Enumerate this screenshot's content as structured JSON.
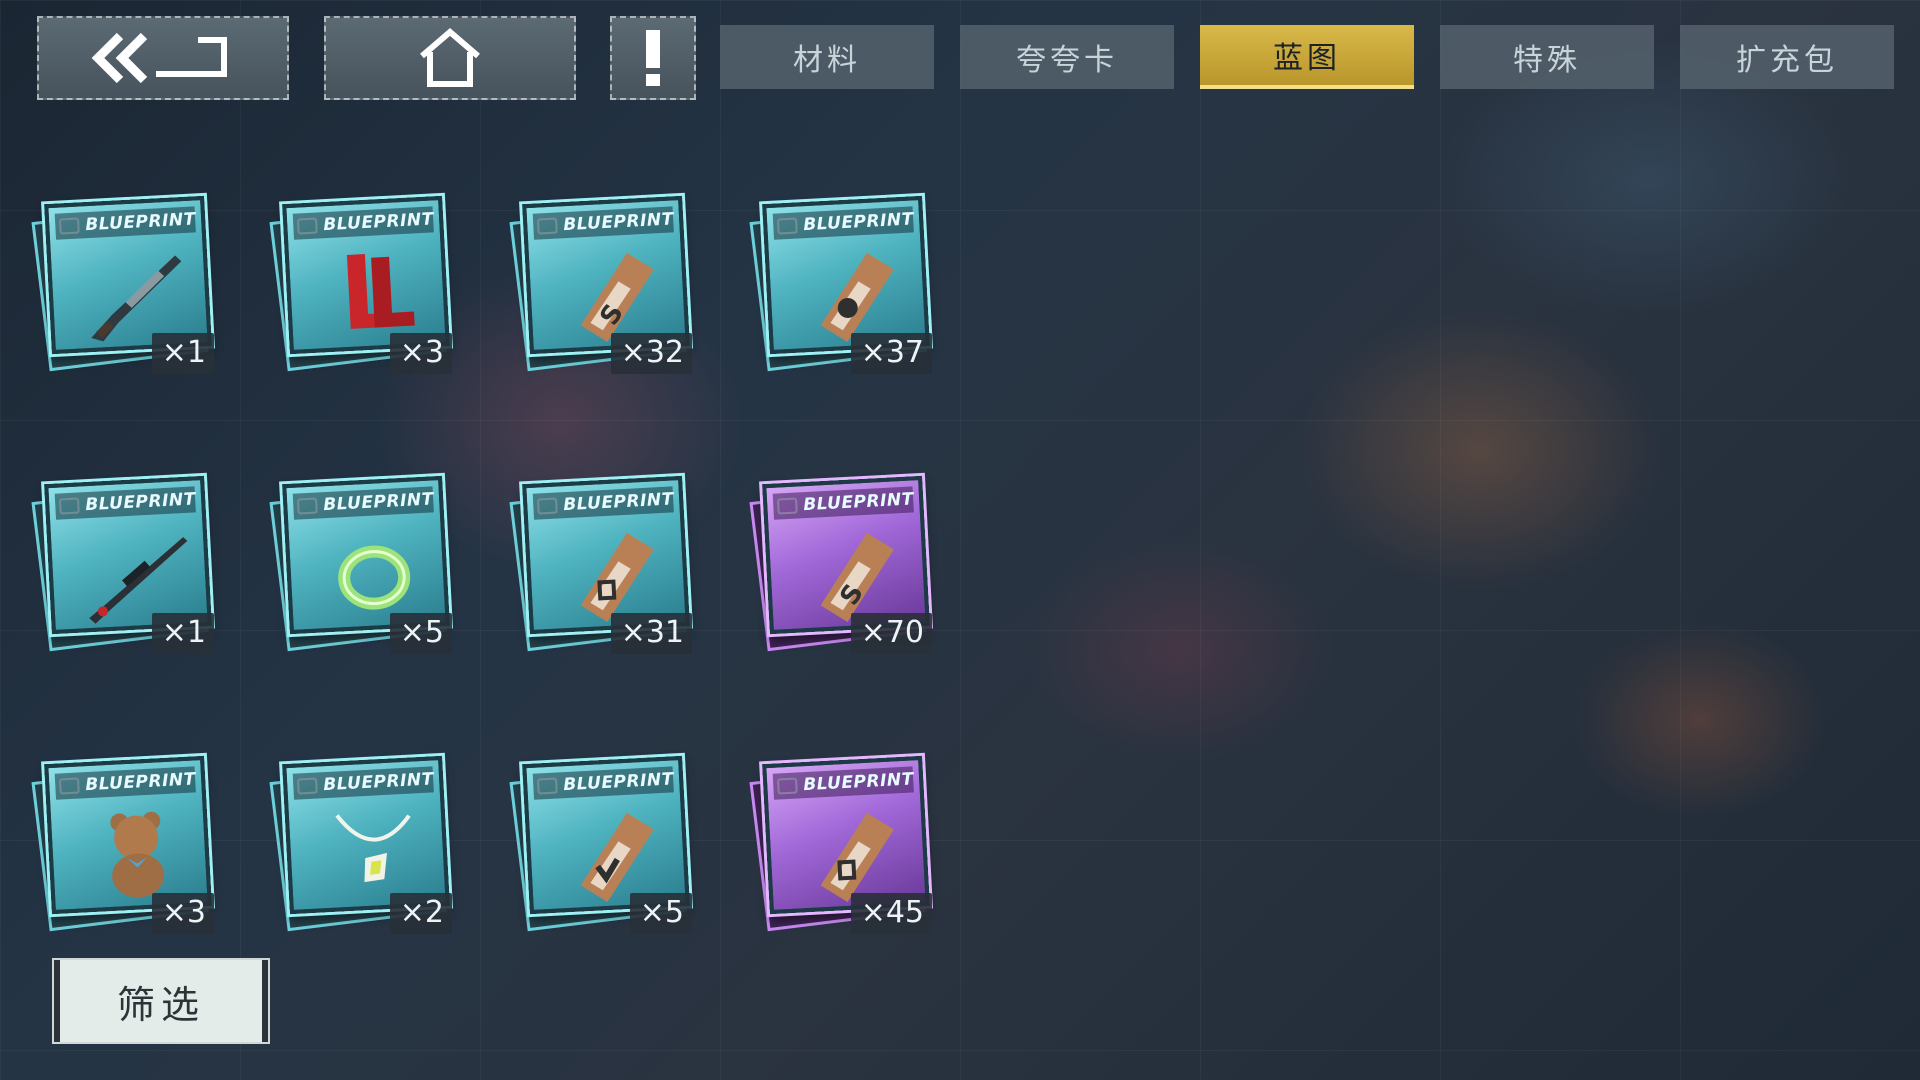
{
  "topbar": {
    "back_icon": "double-chevron-back-icon",
    "home_icon": "home-icon",
    "alert_icon": "exclamation-icon",
    "tabs": [
      {
        "label": "材料",
        "active": false
      },
      {
        "label": "夸夸卡",
        "active": false
      },
      {
        "label": "蓝图",
        "active": true
      },
      {
        "label": "特殊",
        "active": false
      },
      {
        "label": "扩充包",
        "active": false
      }
    ]
  },
  "colors": {
    "active_tab": "#d9b94a",
    "blueprint_cyan": "#4fb3c0",
    "blueprint_purple": "#a168d8"
  },
  "items": [
    {
      "header": "BLUEPRINT",
      "icon": "shotgun-icon",
      "count": "×1",
      "rarity": "blue"
    },
    {
      "header": "BLUEPRINT",
      "icon": "red-boots-icon",
      "count": "×3",
      "rarity": "blue"
    },
    {
      "header": "BLUEPRINT",
      "icon": "ticket-icon",
      "count": "×32",
      "rarity": "blue"
    },
    {
      "header": "BLUEPRINT",
      "icon": "ticket-icon",
      "count": "×37",
      "rarity": "blue"
    },
    {
      "header": "BLUEPRINT",
      "icon": "sniper-rifle-icon",
      "count": "×1",
      "rarity": "blue"
    },
    {
      "header": "BLUEPRINT",
      "icon": "green-ring-icon",
      "count": "×5",
      "rarity": "blue"
    },
    {
      "header": "BLUEPRINT",
      "icon": "ticket-icon",
      "count": "×31",
      "rarity": "blue"
    },
    {
      "header": "BLUEPRINT",
      "icon": "ticket-icon",
      "count": "×70",
      "rarity": "purple"
    },
    {
      "header": "BLUEPRINT",
      "icon": "teddy-bear-icon",
      "count": "×3",
      "rarity": "blue"
    },
    {
      "header": "BLUEPRINT",
      "icon": "necklace-icon",
      "count": "×2",
      "rarity": "blue"
    },
    {
      "header": "BLUEPRINT",
      "icon": "ticket-icon",
      "count": "×5",
      "rarity": "blue"
    },
    {
      "header": "BLUEPRINT",
      "icon": "ticket-icon",
      "count": "×45",
      "rarity": "purple"
    }
  ],
  "filter_button": "筛选"
}
